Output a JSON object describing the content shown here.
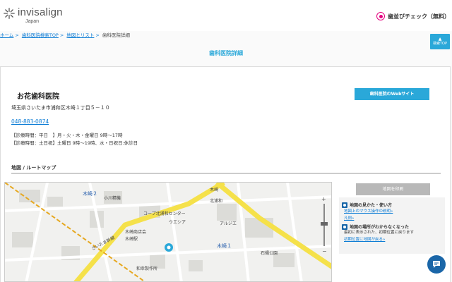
{
  "header": {
    "brand": "invisalign",
    "brand_sub": "Japan",
    "check_label": "歯並びチェック（無料）"
  },
  "breadcrumb": [
    {
      "label": "ホーム",
      "link": true
    },
    {
      "label": "歯科医院検索TOP",
      "link": true
    },
    {
      "label": "地図とリスト",
      "link": true
    },
    {
      "label": "歯科医院詳細",
      "link": false
    }
  ],
  "top_button": {
    "label": "検索TOP"
  },
  "page_title": "歯科医院詳細",
  "clinic": {
    "name": "お花歯科医院",
    "website_button": "歯科医院のWebサイト",
    "address": "埼玉県さいたま市浦和区木崎１丁目５－１０",
    "phone": "048-883-0874",
    "hours_weekday": "【診療時間：平日　】月・火・木・金曜日 9時〜17時",
    "hours_weekend": "【診療時間：土日祝】土曜日 9時〜19時、水・日祝日:休診日"
  },
  "map": {
    "heading": "地図 / ルートマップ",
    "labels": {
      "kizaki2": "木崎２",
      "kizaki1": "木崎１",
      "kizaki": "木崎",
      "north_urawa": "北浦和",
      "kizaki_station": "木崎駅",
      "hotel": "小川精機",
      "coop": "コープ北浦和センター",
      "ueshiya": "ウエシア",
      "arwaseya": "アルジエ",
      "ishiki_park": "石縄公園",
      "wakinouchi": "和幸製作所",
      "road": "さいたま幹線",
      "kizaki_shopping": "木崎商店会"
    },
    "colors": {
      "main_road": "#f5e14a",
      "minor_road": "#ffffff",
      "building": "#dcdcd8",
      "rail": "#e6a820",
      "pin": "#2aa8d9"
    }
  },
  "side": {
    "print_button": "地図を印刷",
    "section1_title": "地図の見かた・使い方",
    "section1_links": [
      "地図上のマウス操作の説明»",
      "凡例»"
    ],
    "section2_title": "地図の場所がわからなくなった",
    "section2_text": "最初に表示された、初期位置に戻ります",
    "section2_link": "初期位置に地図が戻る»"
  }
}
